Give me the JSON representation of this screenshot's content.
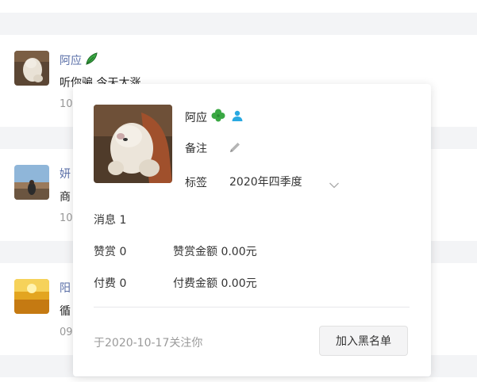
{
  "rows": [
    {
      "name": "阿应",
      "text": "听你骗 今天太涨",
      "time": "10"
    },
    {
      "name": "妍",
      "text": "商",
      "time": "10"
    },
    {
      "name": "阳",
      "text": "循",
      "time": "09"
    }
  ],
  "popup": {
    "name": "阿应",
    "name_emoji_icon": "clover-icon",
    "user_badge_icon": "person-icon",
    "remark_label": "备注",
    "tag_label": "标签",
    "tag_value": "2020年四季度",
    "messages": "消息 1",
    "reward": "赞赏 0",
    "reward_amount": "赞赏金额 0.00元",
    "paid": "付费 0",
    "paid_amount": "付费金额 0.00元",
    "follow_date": "于2020-10-17关注你",
    "blacklist_button": "加入黑名单"
  },
  "colors": {
    "page_bg": "#f3f4f6",
    "name_link": "#5a6fa8",
    "badge_blue": "#29a9e1",
    "clover_green": "#3aa843"
  }
}
